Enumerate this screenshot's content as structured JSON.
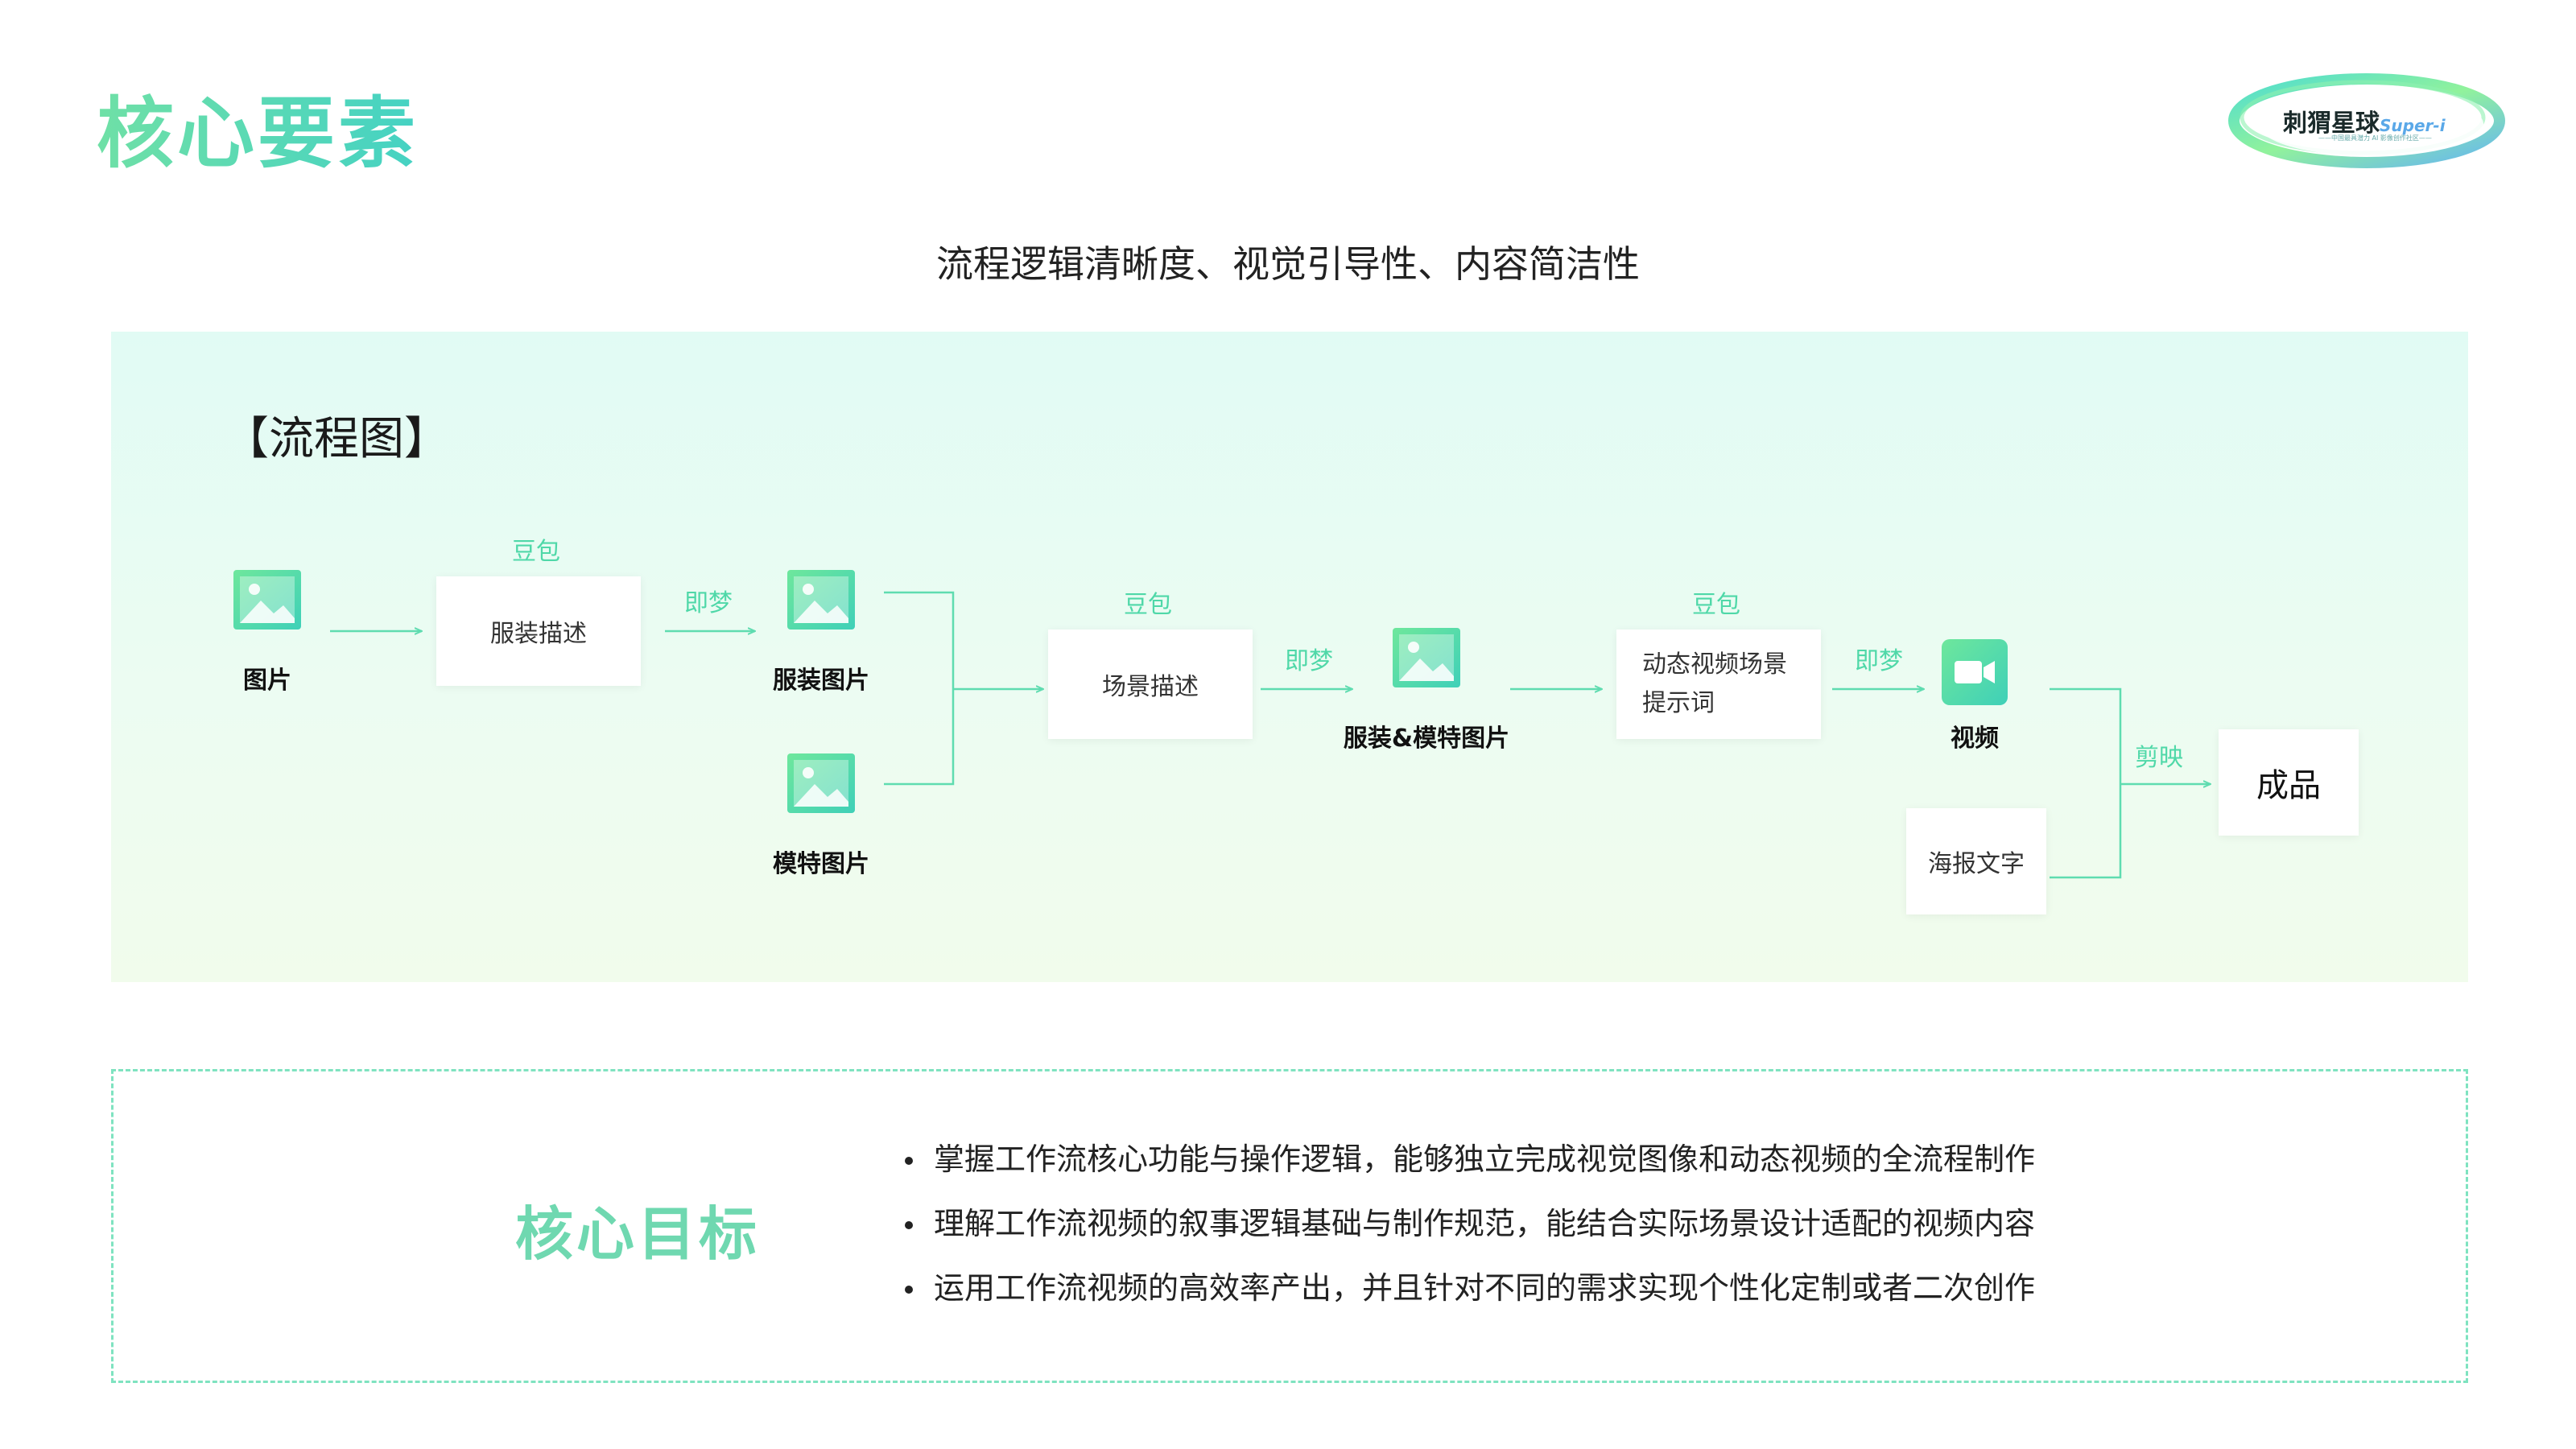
{
  "page": {
    "title": "核心要素",
    "subtitle": "流程逻辑清晰度、视觉引导性、内容简洁性"
  },
  "logo": {
    "name": "刺猬星球",
    "suffix": "Super-i",
    "tagline": "——中国最具潜力 AI 影像创作社区——"
  },
  "flowchart": {
    "title": "【流程图】",
    "nodes": {
      "image": "图片",
      "clothing_desc": "服装描述",
      "clothing_image": "服装图片",
      "model_image": "模特图片",
      "scene_desc": "场景描述",
      "clothing_model_image": "服装&模特图片",
      "video_prompt": "动态视频场景\n提示词",
      "video": "视频",
      "poster_text": "海报文字",
      "final": "成品"
    },
    "tools": {
      "doubao_1": "豆包",
      "jimeng_1": "即梦",
      "doubao_2": "豆包",
      "jimeng_2": "即梦",
      "doubao_3": "豆包",
      "jimeng_3": "即梦",
      "jianying": "剪映"
    }
  },
  "goals": {
    "title": "核心目标",
    "items": [
      "掌握工作流核心功能与操作逻辑，能够独立完成视觉图像和动态视频的全流程制作",
      "理解工作流视频的叙事逻辑基础与制作规范，能结合实际场景设计适配的视频内容",
      "运用工作流视频的高效率产出，并且针对不同的需求实现个性化定制或者二次创作"
    ]
  },
  "colors": {
    "accent": "#4fd8a8",
    "title_gradient_start": "#6fe0a6",
    "title_gradient_end": "#45d2c3",
    "panel_bg": "#e6fbf3",
    "icon_gradient_start": "#6ee79c",
    "icon_gradient_end": "#3fd0b8"
  },
  "icons": {
    "image": "image-icon",
    "video": "video-camera-icon"
  }
}
